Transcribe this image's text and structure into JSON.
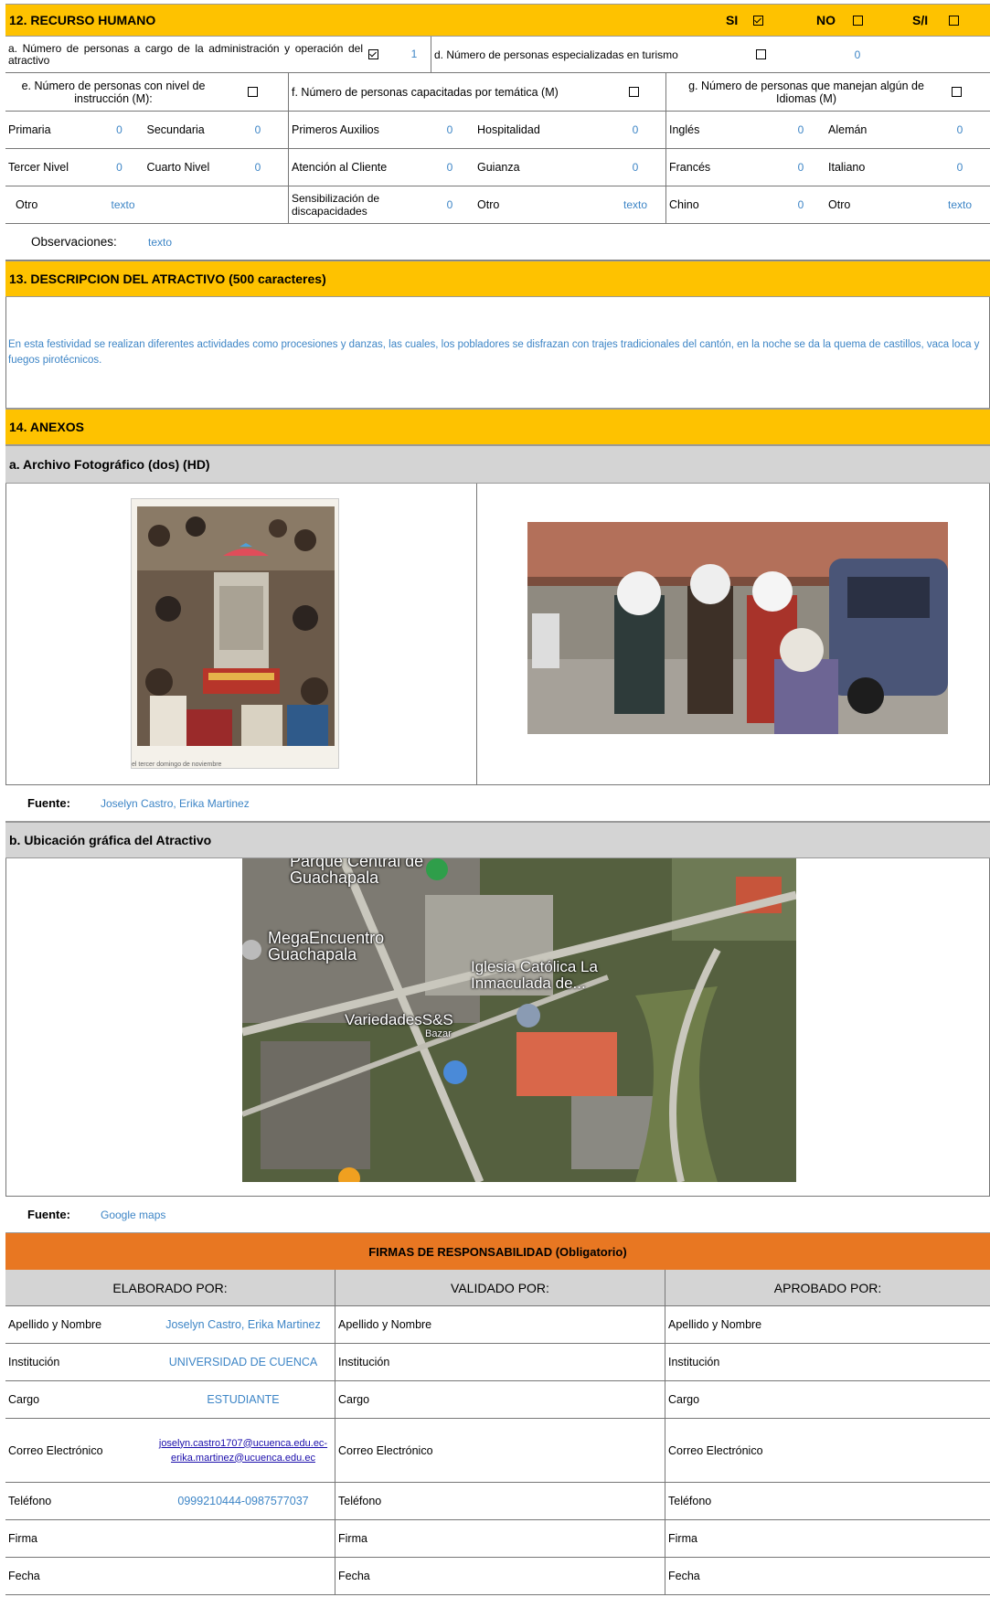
{
  "recurso": {
    "title": "12. RECURSO HUMANO",
    "si": "SI",
    "no": "NO",
    "si_no": "S/I",
    "a_label": "a. Número de personas a cargo de la administración y operación del atractivo",
    "a_value": "1",
    "d_label": "d. Número de personas especializadas en turismo",
    "d_value": "0",
    "e_label": "e. Número de personas con nivel de instrucción (M):",
    "f_label": "f. Número de personas capacitadas por temática (M)",
    "g_label": "g. Número de personas que manejan algún de Idiomas (M)",
    "rows": [
      [
        "Primaria",
        "0",
        "Secundaria",
        "0",
        "Primeros Auxilios",
        "0",
        "Hospitalidad",
        "0",
        "Inglés",
        "0",
        "Alemán",
        "0"
      ],
      [
        "Tercer Nivel",
        "0",
        "Cuarto Nivel",
        "0",
        "Atención al Cliente",
        "0",
        "Guianza",
        "0",
        "Francés",
        "0",
        "Italiano",
        "0"
      ],
      [
        "Otro",
        "texto",
        "",
        "",
        "Sensibilización de discapacidades",
        "0",
        "Otro",
        "texto",
        "Chino",
        "0",
        "Otro",
        "texto"
      ]
    ],
    "obs_label": "Observaciones:",
    "obs_value": "texto"
  },
  "descripcion": {
    "title": "13. DESCRIPCION DEL ATRACTIVO (500 caracteres)",
    "text": "En esta festividad se realizan diferentes actividades como procesiones y danzas, las cuales, los pobladores se disfrazan con trajes tradicionales del cantón, en la noche se da la quema de castillos, vaca loca y fuegos pirotécnicos."
  },
  "anexos": {
    "title": "14. ANEXOS",
    "foto_title": "a. Archivo Fotográfico (dos) (HD)",
    "photo_caption": "el tercer domingo de noviembre",
    "fuente_label": "Fuente:",
    "fuente_foto": "Joselyn Castro, Erika Martinez",
    "ubicacion_title": "b. Ubicación gráfica del Atractivo",
    "map_labels": [
      "Parque Central de Guachapala",
      "MegaEncuentro Guachapala",
      "Iglesia Católica La Inmaculada de...",
      "VariedadesS&S",
      "Bazar"
    ],
    "fuente_mapa": "Google maps"
  },
  "firmas": {
    "title": "FIRMAS DE RESPONSABILIDAD (Obligatorio)",
    "cols": [
      "ELABORADO POR:",
      "VALIDADO  POR:",
      "APROBADO POR:"
    ],
    "labels": [
      "Apellido y Nombre",
      "Institución",
      "Cargo",
      "Correo Electrónico",
      "Teléfono",
      "Firma",
      "Fecha"
    ],
    "elaborado": {
      "nombre": "Joselyn Castro, Erika Martinez",
      "institucion": "UNIVERSIDAD DE CUENCA",
      "cargo": "ESTUDIANTE",
      "correo1": "joselyn.castro1707@ucuenca.edu.ec-",
      "correo2": "erika.martinez@ucuenca.edu.ec",
      "telefono": "0999210444-0987577037"
    }
  },
  "colors": {
    "header_yellow": "#fec200",
    "header_orange": "#e87722",
    "gray": "#d4d4d4",
    "value_blue": "#3d85c6"
  }
}
